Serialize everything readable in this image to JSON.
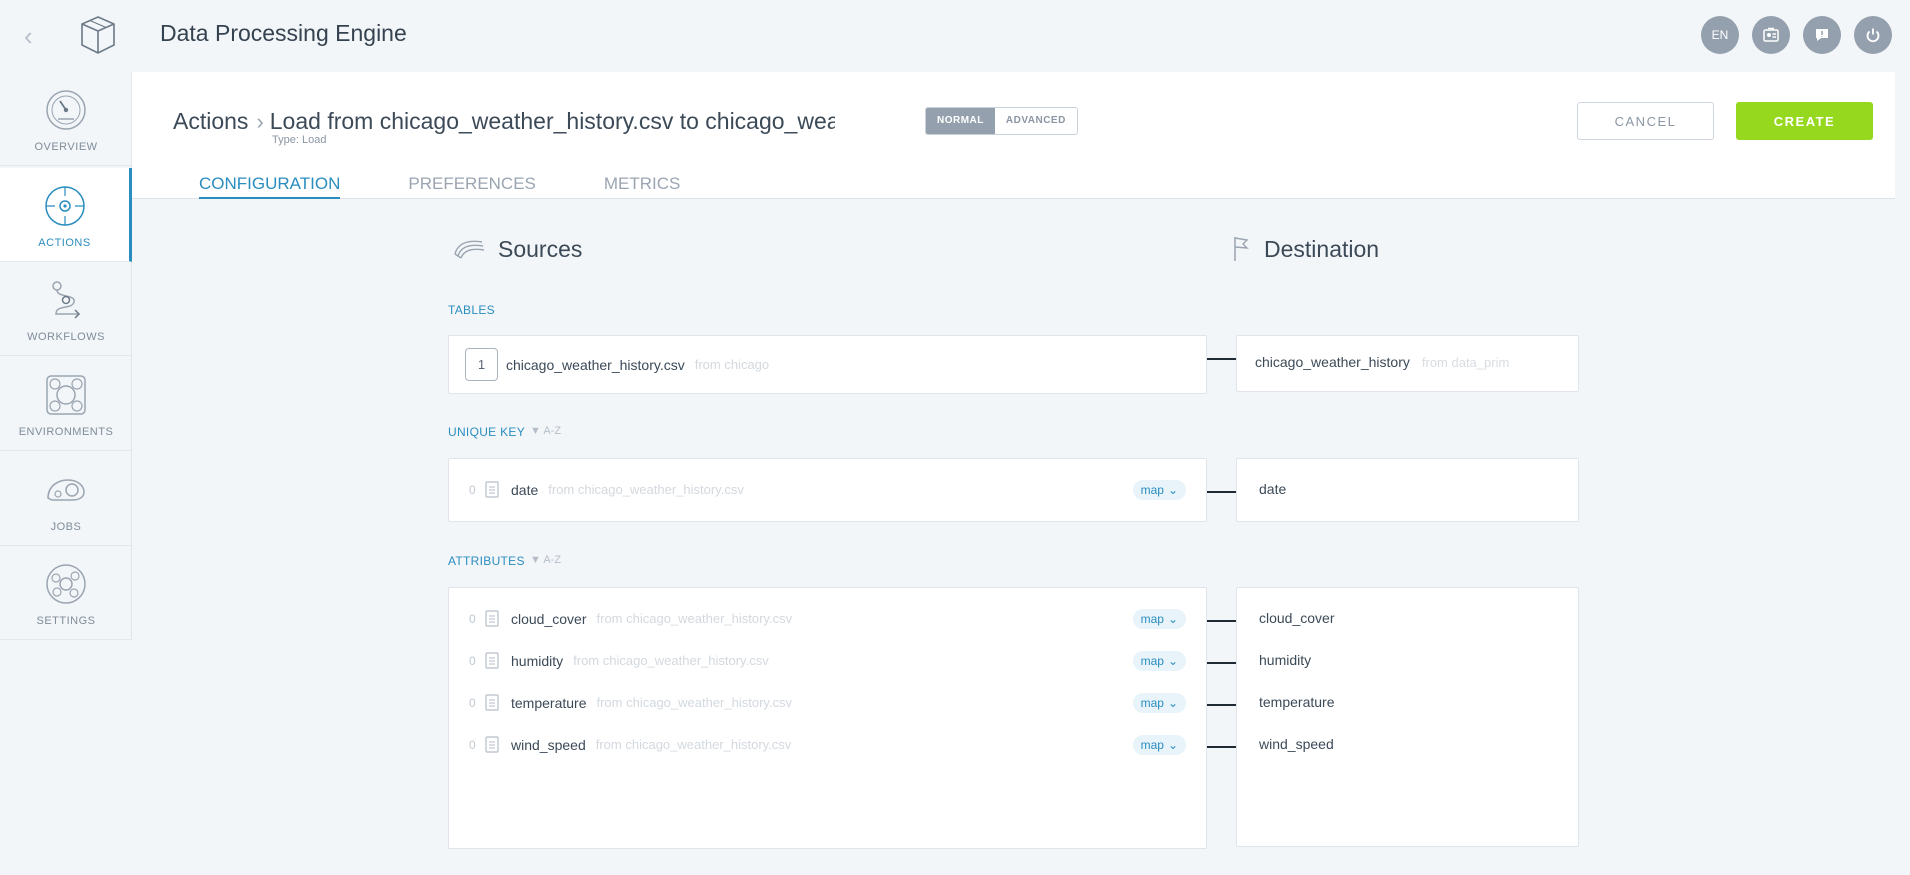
{
  "app": {
    "title": "Data Processing Engine"
  },
  "topbar": {
    "lang": "EN"
  },
  "sidebar": {
    "items": [
      {
        "label": "OVERVIEW",
        "icon": "gauge-icon",
        "active": false
      },
      {
        "label": "ACTIONS",
        "icon": "target-icon",
        "active": true
      },
      {
        "label": "WORKFLOWS",
        "icon": "workflow-icon",
        "active": false
      },
      {
        "label": "ENVIRONMENTS",
        "icon": "environment-icon",
        "active": false
      },
      {
        "label": "JOBS",
        "icon": "jobs-icon",
        "active": false
      },
      {
        "label": "SETTINGS",
        "icon": "gear-icon",
        "active": false
      }
    ]
  },
  "header": {
    "breadcrumb_root": "Actions",
    "action_title": "Load from chicago_weather_history.csv to chicago_weather_history",
    "type_label": "Type: Load",
    "mode": {
      "normal": "NORMAL",
      "advanced": "ADVANCED",
      "selected": "NORMAL"
    },
    "cancel_label": "CANCEL",
    "create_label": "CREATE",
    "tabs": [
      "CONFIGURATION",
      "PREFERENCES",
      "METRICS"
    ],
    "active_tab": "CONFIGURATION"
  },
  "sources": {
    "heading": "Sources",
    "tables_label": "TABLES",
    "table": {
      "index": "1",
      "name": "chicago_weather_history.csv",
      "from": "from chicago"
    },
    "unique_key_label": "UNIQUE KEY",
    "sort_label": "▼ A-Z",
    "unique_key": {
      "count": "0",
      "name": "date",
      "from": "from chicago_weather_history.csv",
      "map": "map"
    },
    "attributes_label": "ATTRIBUTES",
    "attributes": [
      {
        "count": "0",
        "name": "cloud_cover",
        "from": "from chicago_weather_history.csv",
        "map": "map"
      },
      {
        "count": "0",
        "name": "humidity",
        "from": "from chicago_weather_history.csv",
        "map": "map"
      },
      {
        "count": "0",
        "name": "temperature",
        "from": "from chicago_weather_history.csv",
        "map": "map"
      },
      {
        "count": "0",
        "name": "wind_speed",
        "from": "from chicago_weather_history.csv",
        "map": "map"
      }
    ]
  },
  "destination": {
    "heading": "Destination",
    "table": {
      "name": "chicago_weather_history",
      "from": "from data_prim"
    },
    "unique_key": "date",
    "attributes": [
      "cloud_cover",
      "humidity",
      "temperature",
      "wind_speed"
    ]
  }
}
